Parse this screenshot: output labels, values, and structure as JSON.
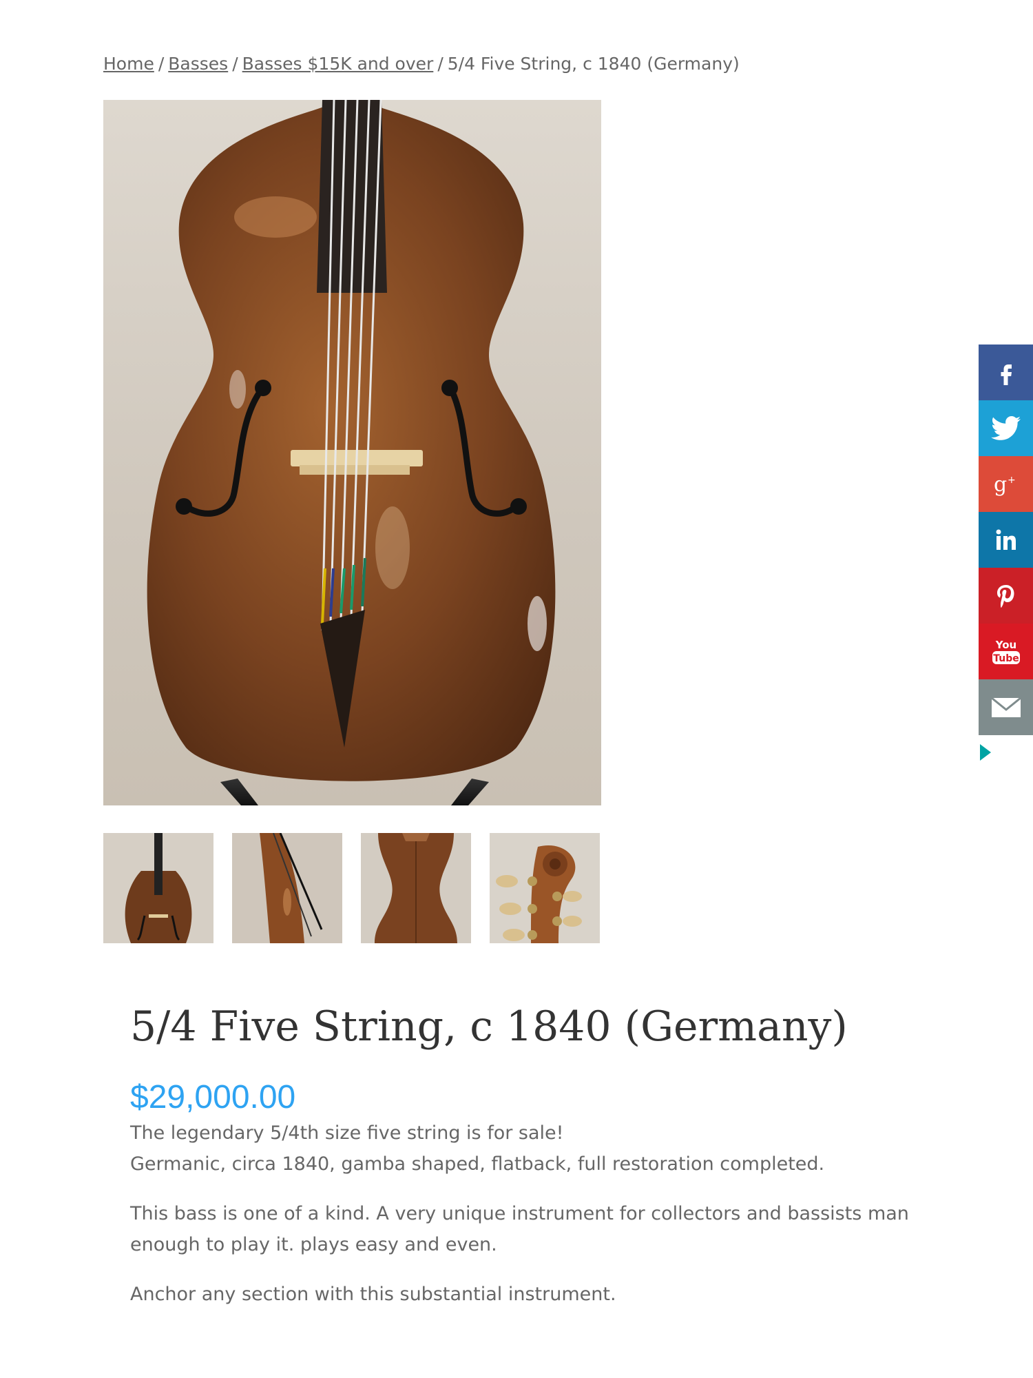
{
  "breadcrumb": {
    "items": [
      {
        "label": "Home"
      },
      {
        "label": "Basses"
      },
      {
        "label": "Basses $15K and over"
      }
    ],
    "separator": "/",
    "current": "5/4 Five String, c 1840 (Germany)"
  },
  "product": {
    "title": "5/4 Five String, c 1840 (Germany)",
    "price": "$29,000.00",
    "description": {
      "line1": "The legendary 5/4th size five string is for sale!",
      "line2": "Germanic, circa 1840, gamba shaped, flatback, full restoration completed.",
      "para2": "This bass is one of a kind. A very unique instrument for collectors and bassists man enough to play it. plays easy and even.",
      "para3": "Anchor any section with this substantial instrument."
    }
  },
  "gallery": {
    "main_image": "bass-front-photo",
    "thumbnails": [
      "bass-front-thumb",
      "bass-side-thumb",
      "bass-back-thumb",
      "bass-scroll-thumb"
    ]
  },
  "share": {
    "buttons": [
      {
        "icon": "facebook-icon",
        "color": "#3b5998"
      },
      {
        "icon": "twitter-icon",
        "color": "#1da1d6"
      },
      {
        "icon": "google-plus-icon",
        "color": "#dd4b39"
      },
      {
        "icon": "linkedin-icon",
        "color": "#0e76a8"
      },
      {
        "icon": "pinterest-icon",
        "color": "#cb2027"
      },
      {
        "icon": "youtube-icon",
        "color": "#d91a24"
      },
      {
        "icon": "email-icon",
        "color": "#7f8c8d"
      }
    ],
    "toggle_color": "#00a3a3"
  },
  "colors": {
    "accent": "#2ea3f2",
    "text": "#666666",
    "heading": "#333333"
  }
}
